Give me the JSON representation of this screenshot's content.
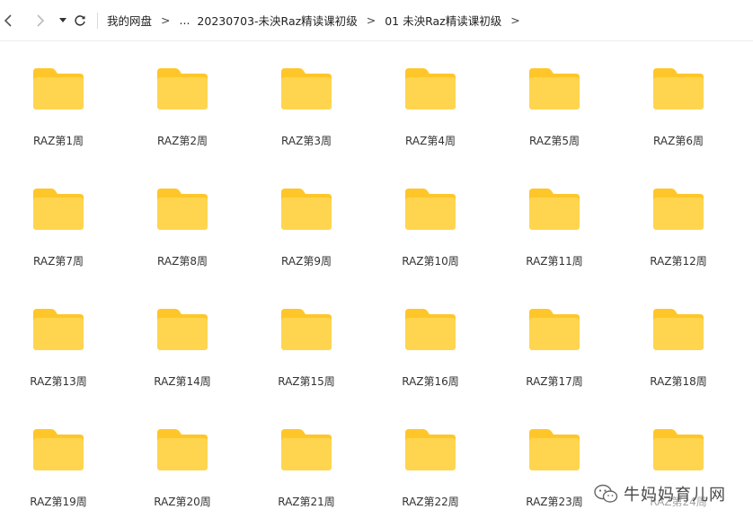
{
  "toolbar": {
    "breadcrumb": [
      "我的网盘",
      "...",
      "20230703-未泱Raz精读课初级",
      "01 未泱Raz精读课初级"
    ],
    "separator": ">"
  },
  "folder_color": "#FFD54F",
  "folder_tab_color": "#FFC629",
  "folders": [
    {
      "label": "RAZ第1周"
    },
    {
      "label": "RAZ第2周"
    },
    {
      "label": "RAZ第3周"
    },
    {
      "label": "RAZ第4周"
    },
    {
      "label": "RAZ第5周"
    },
    {
      "label": "RAZ第6周"
    },
    {
      "label": "RAZ第7周"
    },
    {
      "label": "RAZ第8周"
    },
    {
      "label": "RAZ第9周"
    },
    {
      "label": "RAZ第10周"
    },
    {
      "label": "RAZ第11周"
    },
    {
      "label": "RAZ第12周"
    },
    {
      "label": "RAZ第13周"
    },
    {
      "label": "RAZ第14周"
    },
    {
      "label": "RAZ第15周"
    },
    {
      "label": "RAZ第16周"
    },
    {
      "label": "RAZ第17周"
    },
    {
      "label": "RAZ第18周"
    },
    {
      "label": "RAZ第19周"
    },
    {
      "label": "RAZ第20周"
    },
    {
      "label": "RAZ第21周"
    },
    {
      "label": "RAZ第22周"
    },
    {
      "label": "RAZ第23周"
    },
    {
      "label": "RAZ第24周"
    }
  ],
  "watermark": {
    "text": "牛妈妈育儿网",
    "icon": "wechat-icon"
  }
}
